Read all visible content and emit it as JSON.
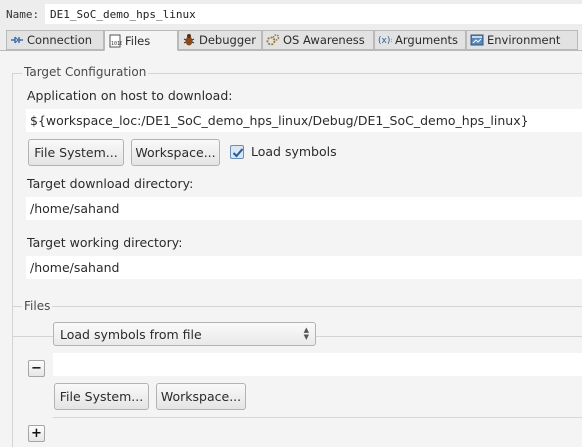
{
  "name_row": {
    "label": "Name:",
    "value": "DE1_SoC_demo_hps_linux"
  },
  "tabs": [
    {
      "label": "Connection",
      "icon": "connection-icon"
    },
    {
      "label": "Files",
      "icon": "files-icon",
      "active": true
    },
    {
      "label": "Debugger",
      "icon": "bug-icon"
    },
    {
      "label": "OS Awareness",
      "icon": "gear-icon"
    },
    {
      "label": "Arguments",
      "icon": "arguments-icon"
    },
    {
      "label": "Environment",
      "icon": "environment-icon"
    }
  ],
  "target_config": {
    "title": "Target Configuration",
    "app_label": "Application on host to download:",
    "app_path": "${workspace_loc:/DE1_SoC_demo_hps_linux/Debug/DE1_SoC_demo_hps_linux}",
    "file_system_button": "File System...",
    "workspace_button": "Workspace...",
    "load_symbols_label": "Load symbols",
    "load_symbols_checked": true,
    "download_dir_label": "Target download directory:",
    "download_dir": "/home/sahand",
    "working_dir_label": "Target working directory:",
    "working_dir": "/home/sahand"
  },
  "files": {
    "title": "Files",
    "combo_value": "Load symbols from file",
    "file_path": "",
    "file_system_button": "File System...",
    "workspace_button": "Workspace...",
    "remove_button": "−",
    "add_button": "+"
  },
  "colors": {
    "panel_bg": "#f4f4f4",
    "outer_bg": "#ededed",
    "checkbox_accent": "#4a79b0"
  }
}
